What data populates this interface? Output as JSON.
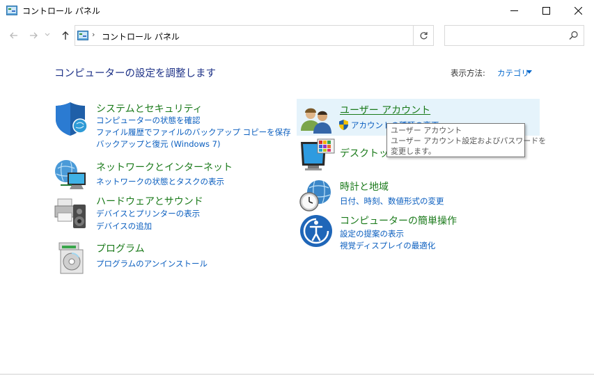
{
  "window": {
    "title": "コントロール パネル"
  },
  "nav": {
    "breadcrumb": [
      "コントロール パネル"
    ],
    "search_placeholder": ""
  },
  "header": {
    "heading": "コンピューターの設定を調整します",
    "viewby_label": "表示方法:",
    "viewby_value": "カテゴリ"
  },
  "categories_left": [
    {
      "title": "システムとセキュリティ",
      "icon": "security-shield-icon",
      "links": [
        "コンピューターの状態を確認",
        "ファイル履歴でファイルのバックアップ コピーを保存",
        "バックアップと復元 (Windows 7)"
      ]
    },
    {
      "title": "ネットワークとインターネット",
      "icon": "network-globe-icon",
      "links": [
        "ネットワークの状態とタスクの表示"
      ]
    },
    {
      "title": "ハードウェアとサウンド",
      "icon": "printer-speaker-icon",
      "links": [
        "デバイスとプリンターの表示",
        "デバイスの追加"
      ]
    },
    {
      "title": "プログラム",
      "icon": "programs-disc-icon",
      "links": [
        "プログラムのアンインストール"
      ]
    }
  ],
  "categories_right": [
    {
      "title": "ユーザー アカウント",
      "icon": "users-icon",
      "links": [
        "アカウントの種類の変更"
      ]
    },
    {
      "title": "デスクトップのカスタマイズ",
      "icon": "display-palette-icon",
      "links": []
    },
    {
      "title": "時計と地域",
      "icon": "clock-globe-icon",
      "links": [
        "日付、時刻、数値形式の変更"
      ]
    },
    {
      "title": "コンピューターの簡単操作",
      "icon": "ease-of-access-icon",
      "links": [
        "設定の提案の表示",
        "視覚ディスプレイの最適化"
      ]
    }
  ],
  "tooltip": {
    "line1": "ユーザー アカウント",
    "line2": "ユーザー アカウント設定およびパスワードを",
    "line3": "変更します。"
  },
  "colors": {
    "heading": "#1e3287",
    "category_title": "#1a7a1a",
    "link": "#0a5ebf",
    "hover": "#e5f3fb"
  }
}
